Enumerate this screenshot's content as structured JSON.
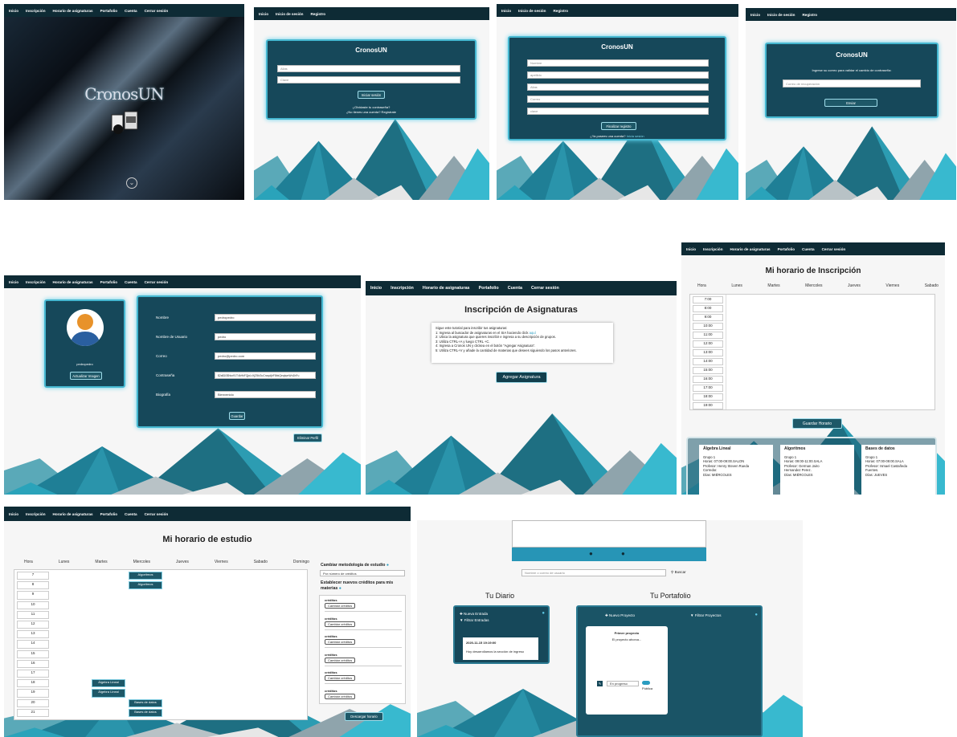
{
  "p1": {
    "nav": [
      "Inicio",
      "Inscripción",
      "Horario de asignaturas",
      "Portafolio",
      "Cuenta",
      "Cerrar sesión"
    ],
    "logo": "CronosUN"
  },
  "p2": {
    "nav": [
      "Inicio",
      "Inicio de sesión",
      "Registro"
    ],
    "title": "CronosUN",
    "alias_ph": "Alias",
    "clave_ph": "Clave",
    "btn": "Iniciar sesión",
    "link1": "¿Olvidaste tu contraseña?",
    "link2": "¿No tienes una cuenta? Regístrate"
  },
  "p3": {
    "nav": [
      "Inicio",
      "Inicio de sesión",
      "Registro"
    ],
    "title": "CronosUN",
    "fields": [
      "Nombre",
      "apellido",
      "Alias",
      "Correo",
      "clave"
    ],
    "btn": "Finalizar registro",
    "link": "¿Ya posees una cuenta?",
    "link_accent": "Inicia sesión"
  },
  "p4": {
    "nav": [
      "Inicio",
      "Inicio de sesión",
      "Registro"
    ],
    "title": "CronosUN",
    "desc": "Ingrese su correo para validar el cambio de contraseña:",
    "ph": "Correo de recuperación",
    "btn": "Enviar"
  },
  "p5": {
    "nav": [
      "Inicio",
      "Inscripción",
      "Horario de asignaturas",
      "Portafolio",
      "Cuenta",
      "Cerrar sesión"
    ],
    "username": "pedropedro",
    "upd_btn": "Actualizar Imagen",
    "labels": [
      "Nombre",
      "Nombre de Usuario",
      "Correo",
      "Contraseña",
      "Biografía"
    ],
    "values": [
      "pedropedro",
      "pedro",
      "pedro@pedro.com",
      "$2a$10$Nvo91T4kHkFQjoLrXjZ5kGuCnzqdjbF8bkQeqbpnWnZnFu",
      "Bienvenido"
    ],
    "edit_btn": "Guardar",
    "del_btn": "Eliminar Perfil"
  },
  "p6": {
    "nav": [
      "Inicio",
      "Inscripción",
      "Horario de asignaturas",
      "Portafolio",
      "Cuenta",
      "Cerrar sesión"
    ],
    "title": "Inscripción de Asignaturas",
    "lines": [
      "Sigue este tutorial para inscribir tus asignaturas:",
      "1: Ingresa al buscador de asignaturas en el SIA haciendo click",
      "2: Ubica la asignatura que quieres inscribir e ingresa a su descripción de grupos.",
      "3: Utiliza CTRL+A y luego CTRL +C.",
      "4: Ingresa a Cronos UN y clickea en el botón \"Agregar Asignatura\".",
      "5: Utiliza CTRL+V y añade la cantidad de materias que desees siguiendo los pasos anteriores."
    ],
    "aqui": "aquí",
    "btn": "Agregar Asignatura"
  },
  "p7": {
    "nav": [
      "Inicio",
      "Inscripción",
      "Horario de asignaturas",
      "Portafolio",
      "Cuenta",
      "Cerrar sesión"
    ],
    "title": "Mi horario de Inscripción",
    "days": [
      "Hora",
      "Lunes",
      "Martes",
      "Miercoles",
      "Jueves",
      "Viernes",
      "Sabado"
    ],
    "hours": [
      "7:00",
      "8:00",
      "9:00",
      "10:00",
      "11:00",
      "12:00",
      "13:00",
      "14:00",
      "15:00",
      "16:00",
      "17:00",
      "18:00",
      "19:00"
    ],
    "save": "Guardar Horario",
    "courses": [
      {
        "name": "Álgebra Lineal",
        "lines": [
          "Grupo 1",
          "Horas: 07:00-09:00.SALON",
          "Profesor: Henry Steven Rueda",
          "Corredor.",
          "Días: MIÉRCOLES"
        ]
      },
      {
        "name": "Algoritmos",
        "lines": [
          "Grupo 1",
          "Horas: 09:00-11:00.SALA",
          "Profesor: German Jairo",
          "Hernandez Perez.",
          "Días: MIÉRCOLES"
        ]
      },
      {
        "name": "Bases de datos",
        "lines": [
          "Grupo 1",
          "Horas: 07:00-09:00.SALA",
          "Profesor: Ismael Castañeda",
          "Fuentes.",
          "Días: JUEVES"
        ]
      }
    ]
  },
  "p8": {
    "nav": [
      "Inicio",
      "Inscripción",
      "Horario de asignaturas",
      "Portafolio",
      "Cuenta",
      "Cerrar sesión"
    ],
    "title": "Mi horario de estudio",
    "days": [
      "Hora",
      "Lunes",
      "Martes",
      "Miercoles",
      "Jueves",
      "Viernes",
      "Sabado",
      "Domingo"
    ],
    "hours": [
      "7",
      "8",
      "9",
      "10",
      "11",
      "12",
      "13",
      "14",
      "15",
      "16",
      "17",
      "18",
      "19",
      "20",
      "21"
    ],
    "blocks": [
      {
        "label": "Algoritmos",
        "col": 3,
        "row": 0
      },
      {
        "label": "Algoritmos",
        "col": 3,
        "row": 1
      },
      {
        "label": "Álgebra Lineal",
        "col": 2,
        "row": 11
      },
      {
        "label": "Álgebra Lineal",
        "col": 2,
        "row": 12
      },
      {
        "label": "Bases de datos",
        "col": 3,
        "row": 13
      },
      {
        "label": "Bases de datos",
        "col": 3,
        "row": 14
      }
    ],
    "method_title": "Cambiar metodología de estudio",
    "method_sel": "Por número de créditos",
    "credits_title": "Establecer nuevos créditos para mis materias",
    "credit_label": "créditos",
    "credit_btn": "Cambiar créditos",
    "download": "Descargar horario"
  },
  "p9": {
    "search_ph": "Nombre o correo de usuario",
    "search_btn": "Buscar",
    "diario": "Tu Diario",
    "portafolio": "Tu Portafolio",
    "new_entry": "Nueva Entrada",
    "filter_entries": "Filtrar Entradas",
    "entry_date": "2020-11-15 19:19:00",
    "entry_text": "Hoy desarrollamos la sección de ingreso",
    "new_project": "Nuevo Proyecto",
    "filter_projects": "Filtrar Proyectos",
    "project_title": "Primer proyecto",
    "project_desc": "El proyecto ahorca...",
    "status": "En progreso",
    "public": "Pública"
  }
}
